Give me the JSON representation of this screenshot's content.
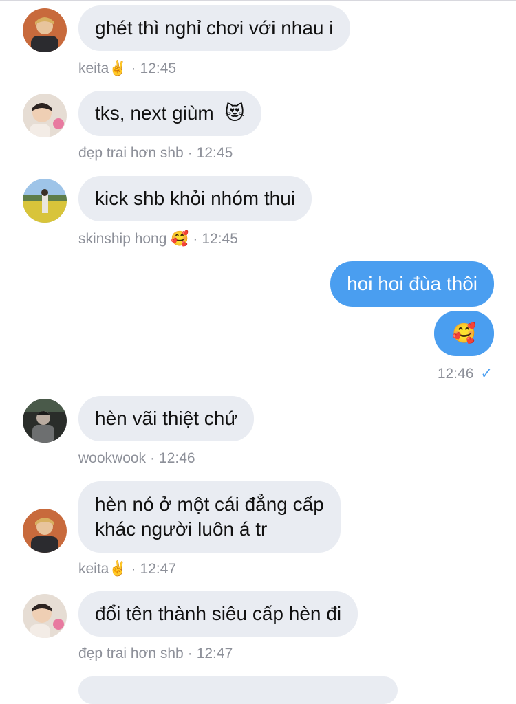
{
  "messages": [
    {
      "sender": "keita",
      "sender_emoji": "✌️",
      "time": "12:45",
      "text": "ghét thì nghỉ chơi với nhau i"
    },
    {
      "sender": "đẹp trai hơn shb",
      "time": "12:45",
      "text": "tks, next giùm",
      "emoji": "😻"
    },
    {
      "sender": "skinship hong",
      "sender_emoji": "🥰",
      "time": "12:45",
      "text": "kick shb khỏi nhóm thui"
    },
    {
      "outgoing": true,
      "texts": [
        "hoi hoi đùa thôi",
        "🥰"
      ],
      "time": "12:46"
    },
    {
      "sender": "wookwook",
      "time": "12:46",
      "text": "hèn vãi thiệt chứ"
    },
    {
      "sender": "keita",
      "sender_emoji": "✌️",
      "time": "12:47",
      "text_lines": [
        "hèn nó ở một cái đẳng cấp",
        "khác người luôn á tr"
      ]
    },
    {
      "sender": "đẹp trai hơn shb",
      "time": "12:47",
      "text": "đổi tên thành siêu cấp hèn đi"
    }
  ],
  "icons": {
    "read_check": "check-icon",
    "accent": "#4a9ef0",
    "bubble_in": "#e9ecf2"
  }
}
